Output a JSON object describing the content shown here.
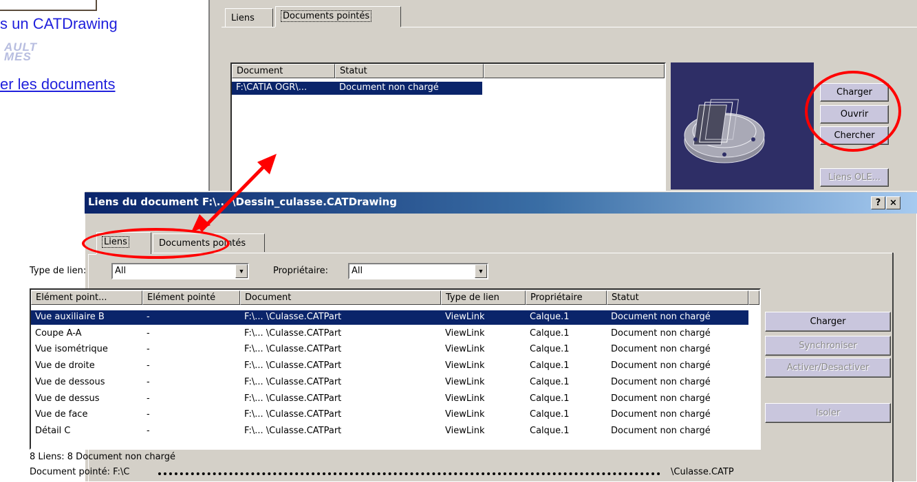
{
  "slide": {
    "line1": "s un CATDrawing",
    "logo_line1": "AULT",
    "logo_line2": "MES",
    "link": "er les documents"
  },
  "background_dialog": {
    "tabs": [
      "Liens",
      "Documents pointés"
    ],
    "active_tab": "Documents pointés",
    "columns": [
      "Document",
      "Statut"
    ],
    "rows": [
      {
        "document": "F:\\CATIA OGR\\...",
        "statut": "Document non chargé",
        "selected": true
      }
    ],
    "buttons": {
      "charger": "Charger",
      "ouvrir": "Ouvrir",
      "chercher": "Chercher",
      "liens_ole": "Liens OLE..."
    }
  },
  "dialog": {
    "title": "Liens du document F:\\... \\Dessin_culasse.CATDrawing",
    "help_button": "?",
    "close_button": "×",
    "tabs": [
      "Liens",
      "Documents pointés"
    ],
    "active_tab": "Liens",
    "filters": {
      "type_label": "Type de lien:",
      "type_value": "All",
      "owner_label": "Propriétaire:",
      "owner_value": "All"
    },
    "columns": [
      "Elément point...",
      "Elément pointé",
      "Document",
      "Type de lien",
      "Propriétaire",
      "Statut"
    ],
    "rows": [
      [
        "Vue auxiliaire B",
        "-",
        "F:\\... \\Culasse.CATPart",
        "ViewLink",
        "Calque.1",
        "Document non chargé"
      ],
      [
        "Coupe A-A",
        "-",
        "F:\\... \\Culasse.CATPart",
        "ViewLink",
        "Calque.1",
        "Document non chargé"
      ],
      [
        "Vue isométrique",
        "-",
        "F:\\... \\Culasse.CATPart",
        "ViewLink",
        "Calque.1",
        "Document non chargé"
      ],
      [
        "Vue de droite",
        "-",
        "F:\\... \\Culasse.CATPart",
        "ViewLink",
        "Calque.1",
        "Document non chargé"
      ],
      [
        "Vue de dessous",
        "-",
        "F:\\... \\Culasse.CATPart",
        "ViewLink",
        "Calque.1",
        "Document non chargé"
      ],
      [
        "Vue de dessus",
        "-",
        "F:\\... \\Culasse.CATPart",
        "ViewLink",
        "Calque.1",
        "Document non chargé"
      ],
      [
        "Vue de face",
        "-",
        "F:\\... \\Culasse.CATPart",
        "ViewLink",
        "Calque.1",
        "Document non chargé"
      ],
      [
        "Détail C",
        "-",
        "F:\\... \\Culasse.CATPart",
        "ViewLink",
        "Calque.1",
        "Document non chargé"
      ]
    ],
    "selected_row": 0,
    "buttons": {
      "charger": "Charger",
      "synchroniser": "Synchroniser",
      "activer": "Activer/Desactiver",
      "isoler": "Isoler"
    },
    "status_line": "8 Liens: 8 Document non chargé",
    "pointed_label": "Document pointé: F:\\C",
    "pointed_suffix": "\\Culasse.CATP"
  },
  "annotation_colors": {
    "highlight": "#ff0000",
    "link_text": "#1f1fdc",
    "selection": "#0a246a"
  }
}
